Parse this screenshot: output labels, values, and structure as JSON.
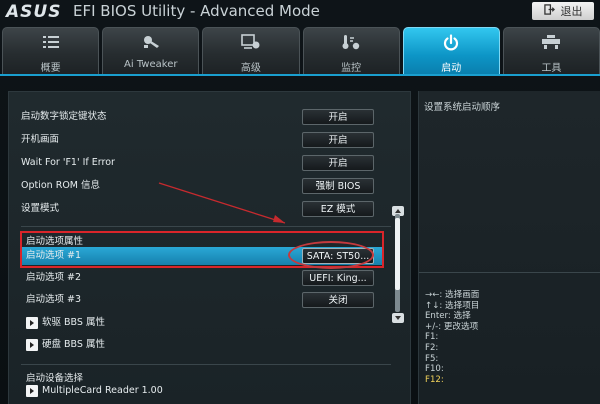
{
  "window": {
    "brand": "ASUS",
    "title": "EFI BIOS Utility - Advanced Mode",
    "exit_label": "退出"
  },
  "tabs": [
    {
      "label": "概要",
      "icon": "list-icon"
    },
    {
      "label": "Ai Tweaker",
      "icon": "tweaker-icon"
    },
    {
      "label": "高级",
      "icon": "advanced-icon"
    },
    {
      "label": "监控",
      "icon": "monitor-icon"
    },
    {
      "label": "启动",
      "icon": "power-icon",
      "active": true
    },
    {
      "label": "工具",
      "icon": "tool-icon"
    }
  ],
  "settings": [
    {
      "label": "启动数字锁定键状态",
      "value": "开启"
    },
    {
      "label": "开机画面",
      "value": "开启"
    },
    {
      "label": "Wait For 'F1' If Error",
      "value": "开启"
    },
    {
      "label": "Option ROM 信息",
      "value": "强制 BIOS"
    },
    {
      "label": "设置模式",
      "value": "EZ 模式"
    }
  ],
  "boot_section": {
    "header": "启动选项属性",
    "options": [
      {
        "label": "启动选项 #1",
        "value": "SATA: ST50...",
        "selected": true
      },
      {
        "label": "启动选项 #2",
        "value": "UEFI: King..."
      },
      {
        "label": "启动选项 #3",
        "value": "关闭"
      }
    ]
  },
  "submenus": [
    {
      "label": "软驱 BBS 属性"
    },
    {
      "label": "硬盘 BBS 属性"
    }
  ],
  "device_section": {
    "header": "启动设备选择",
    "item": "MultipleCard Reader 1.00"
  },
  "help": {
    "text": "设置系统启动顺序",
    "keys": [
      "→←: 选择画面",
      "↑↓: 选择项目",
      "Enter: 选择",
      "+/-: 更改选项",
      "F1:",
      "F2:",
      "F5:",
      "F10:",
      "F12:"
    ]
  },
  "colors": {
    "accent": "#1a9fcf",
    "highlight_box": "#d9252a"
  }
}
